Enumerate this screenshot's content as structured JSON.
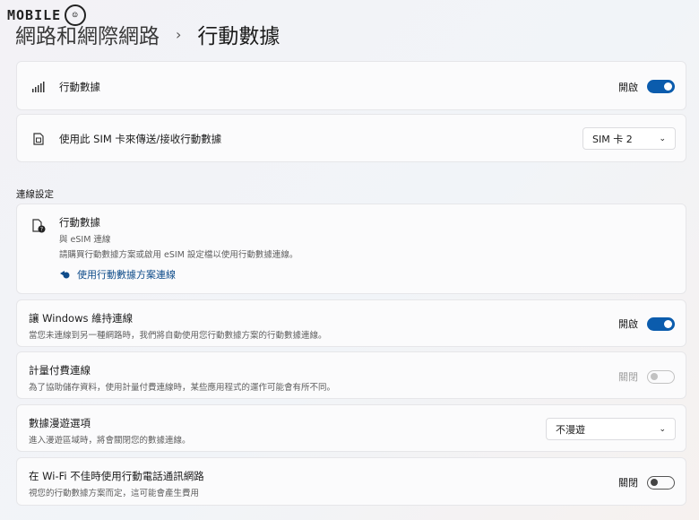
{
  "watermark": {
    "text": "MOBILE"
  },
  "breadcrumb": {
    "parent": "網路和網際網路",
    "separator": "›",
    "current": "行動數據"
  },
  "mobile_data": {
    "label": "行動數據",
    "toggle_label": "開啟",
    "state": "on"
  },
  "sim": {
    "label": "使用此 SIM 卡來傳送/接收行動數據",
    "selected": "SIM 卡 2"
  },
  "connection_settings": {
    "title": "連線設定",
    "esim": {
      "title": "行動數據",
      "subtitle": "與 eSIM 連線",
      "description": "請購買行動數據方案或啟用 eSIM 設定檔以使用行動數據連線。",
      "link_label": "使用行動數據方案連線"
    }
  },
  "keep_connected": {
    "label": "讓 Windows 維持連線",
    "description": "當您未連線到另一種網路時，我們將自動使用您行動數據方案的行動數據連線。",
    "toggle_label": "開啟",
    "state": "on"
  },
  "metered": {
    "label": "計量付費連線",
    "description": "為了協助儲存資料，使用計量付費連線時，某些應用程式的運作可能會有所不同。",
    "toggle_label": "關閉",
    "state": "disabled"
  },
  "roaming": {
    "label": "數據漫遊選項",
    "description": "進入漫遊區域時，將會關閉您的數據連線。",
    "selected": "不漫遊"
  },
  "wifi_fallback": {
    "label": "在 Wi-Fi 不佳時使用行動電話通訊網路",
    "description": "視您的行動數據方案而定，這可能會產生費用",
    "toggle_label": "關閉",
    "state": "off"
  },
  "colors": {
    "accent": "#0b5cad",
    "link": "#0f4c8a"
  }
}
